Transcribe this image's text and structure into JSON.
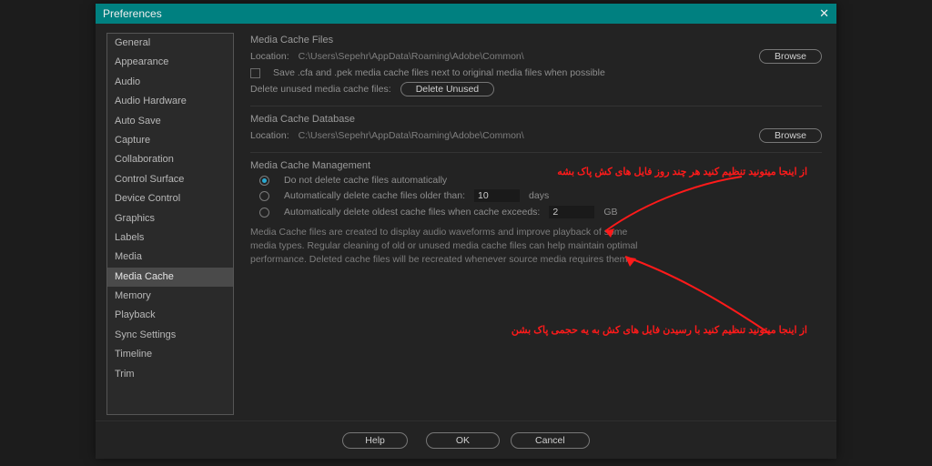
{
  "titlebar": {
    "title": "Preferences",
    "close": "✕"
  },
  "sidebar": {
    "items": [
      {
        "label": "General",
        "sel": false
      },
      {
        "label": "Appearance",
        "sel": false
      },
      {
        "label": "Audio",
        "sel": false
      },
      {
        "label": "Audio Hardware",
        "sel": false
      },
      {
        "label": "Auto Save",
        "sel": false
      },
      {
        "label": "Capture",
        "sel": false
      },
      {
        "label": "Collaboration",
        "sel": false
      },
      {
        "label": "Control Surface",
        "sel": false
      },
      {
        "label": "Device Control",
        "sel": false
      },
      {
        "label": "Graphics",
        "sel": false
      },
      {
        "label": "Labels",
        "sel": false
      },
      {
        "label": "Media",
        "sel": false
      },
      {
        "label": "Media Cache",
        "sel": true
      },
      {
        "label": "Memory",
        "sel": false
      },
      {
        "label": "Playback",
        "sel": false
      },
      {
        "label": "Sync Settings",
        "sel": false
      },
      {
        "label": "Timeline",
        "sel": false
      },
      {
        "label": "Trim",
        "sel": false
      }
    ]
  },
  "cache_files": {
    "heading": "Media Cache Files",
    "location_label": "Location:",
    "location_path": "C:\\Users\\Sepehr\\AppData\\Roaming\\Adobe\\Common\\",
    "browse": "Browse",
    "save_next_label": "Save .cfa and .pek media cache files next to original media files when possible",
    "delete_unused_label": "Delete unused media cache files:",
    "delete_unused_btn": "Delete Unused"
  },
  "cache_db": {
    "heading": "Media Cache Database",
    "location_label": "Location:",
    "location_path": "C:\\Users\\Sepehr\\AppData\\Roaming\\Adobe\\Common\\",
    "browse": "Browse"
  },
  "cache_mgmt": {
    "heading": "Media Cache Management",
    "opt_none": "Do not delete cache files automatically",
    "opt_days_pre": "Automatically delete cache files older than:",
    "days_value": "10",
    "days_unit": "days",
    "opt_size_pre": "Automatically delete oldest cache files when cache exceeds:",
    "size_value": "2",
    "size_unit": "GB",
    "selected": "none",
    "help": "Media Cache files are created to display audio waveforms and improve playback of some media types. Regular cleaning of old or unused media cache files can help maintain optimal performance. Deleted cache files will be recreated whenever source media requires them."
  },
  "annotations": {
    "line1": "از اینجا میتونید تنظیم کنید هر چند روز فایل های کش پاک بشه",
    "line2": "از اینجا میتونید تنظیم کنید با رسیدن فایل های کش به یه حجمی پاک بشن"
  },
  "footer": {
    "help": "Help",
    "ok": "OK",
    "cancel": "Cancel"
  },
  "colors": {
    "teal": "#008080",
    "red": "#ff1a1a"
  }
}
